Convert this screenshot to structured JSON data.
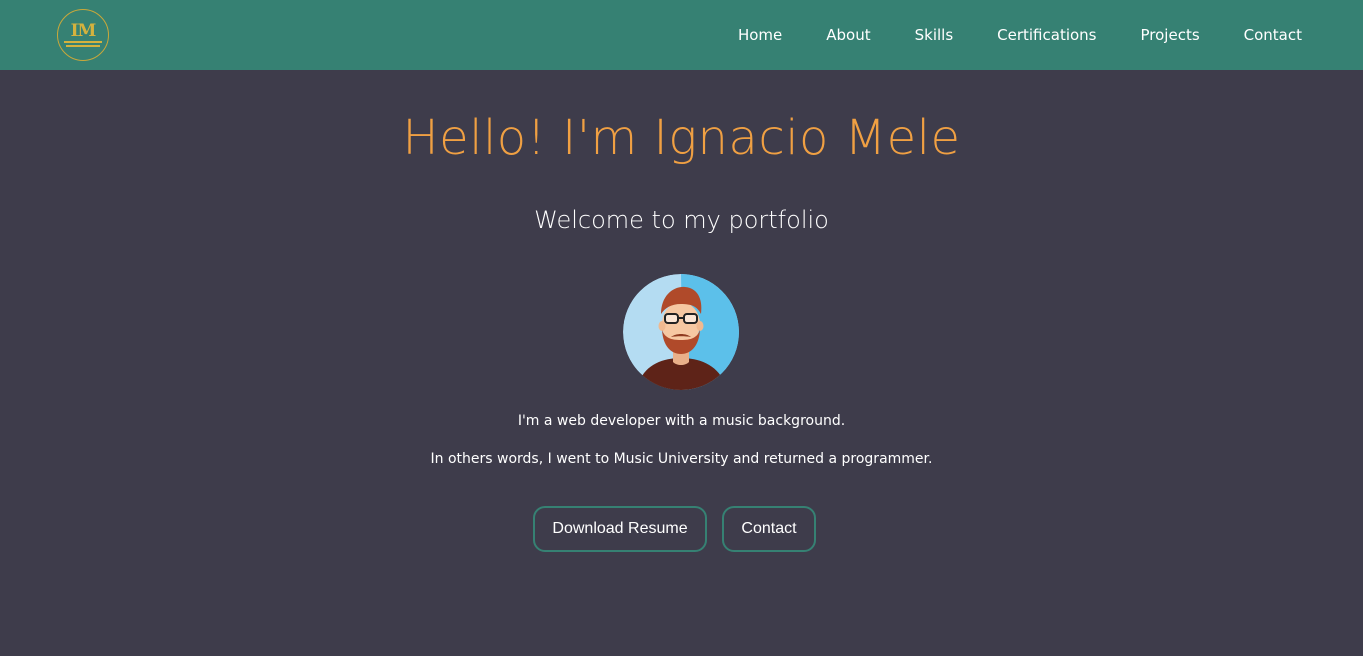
{
  "header": {
    "logo_text": "IM",
    "nav": [
      "Home",
      "About",
      "Skills",
      "Certifications",
      "Projects",
      "Contact"
    ]
  },
  "hero": {
    "title": "Hello! I'm Ignacio Mele",
    "subtitle": "Welcome to my portfolio",
    "avatar_icon": "developer-avatar-illustration",
    "bio_line1": "I'm a web developer with a music background.",
    "bio_line2": "In others words, I went to Music University and returned a programmer.",
    "buttons": {
      "resume_label": "Download Resume",
      "contact_label": "Contact"
    }
  },
  "colors": {
    "navbar": "#368173",
    "background": "#3e3c4b",
    "accent": "#f0a043",
    "logo_gold": "#d4b23e"
  }
}
